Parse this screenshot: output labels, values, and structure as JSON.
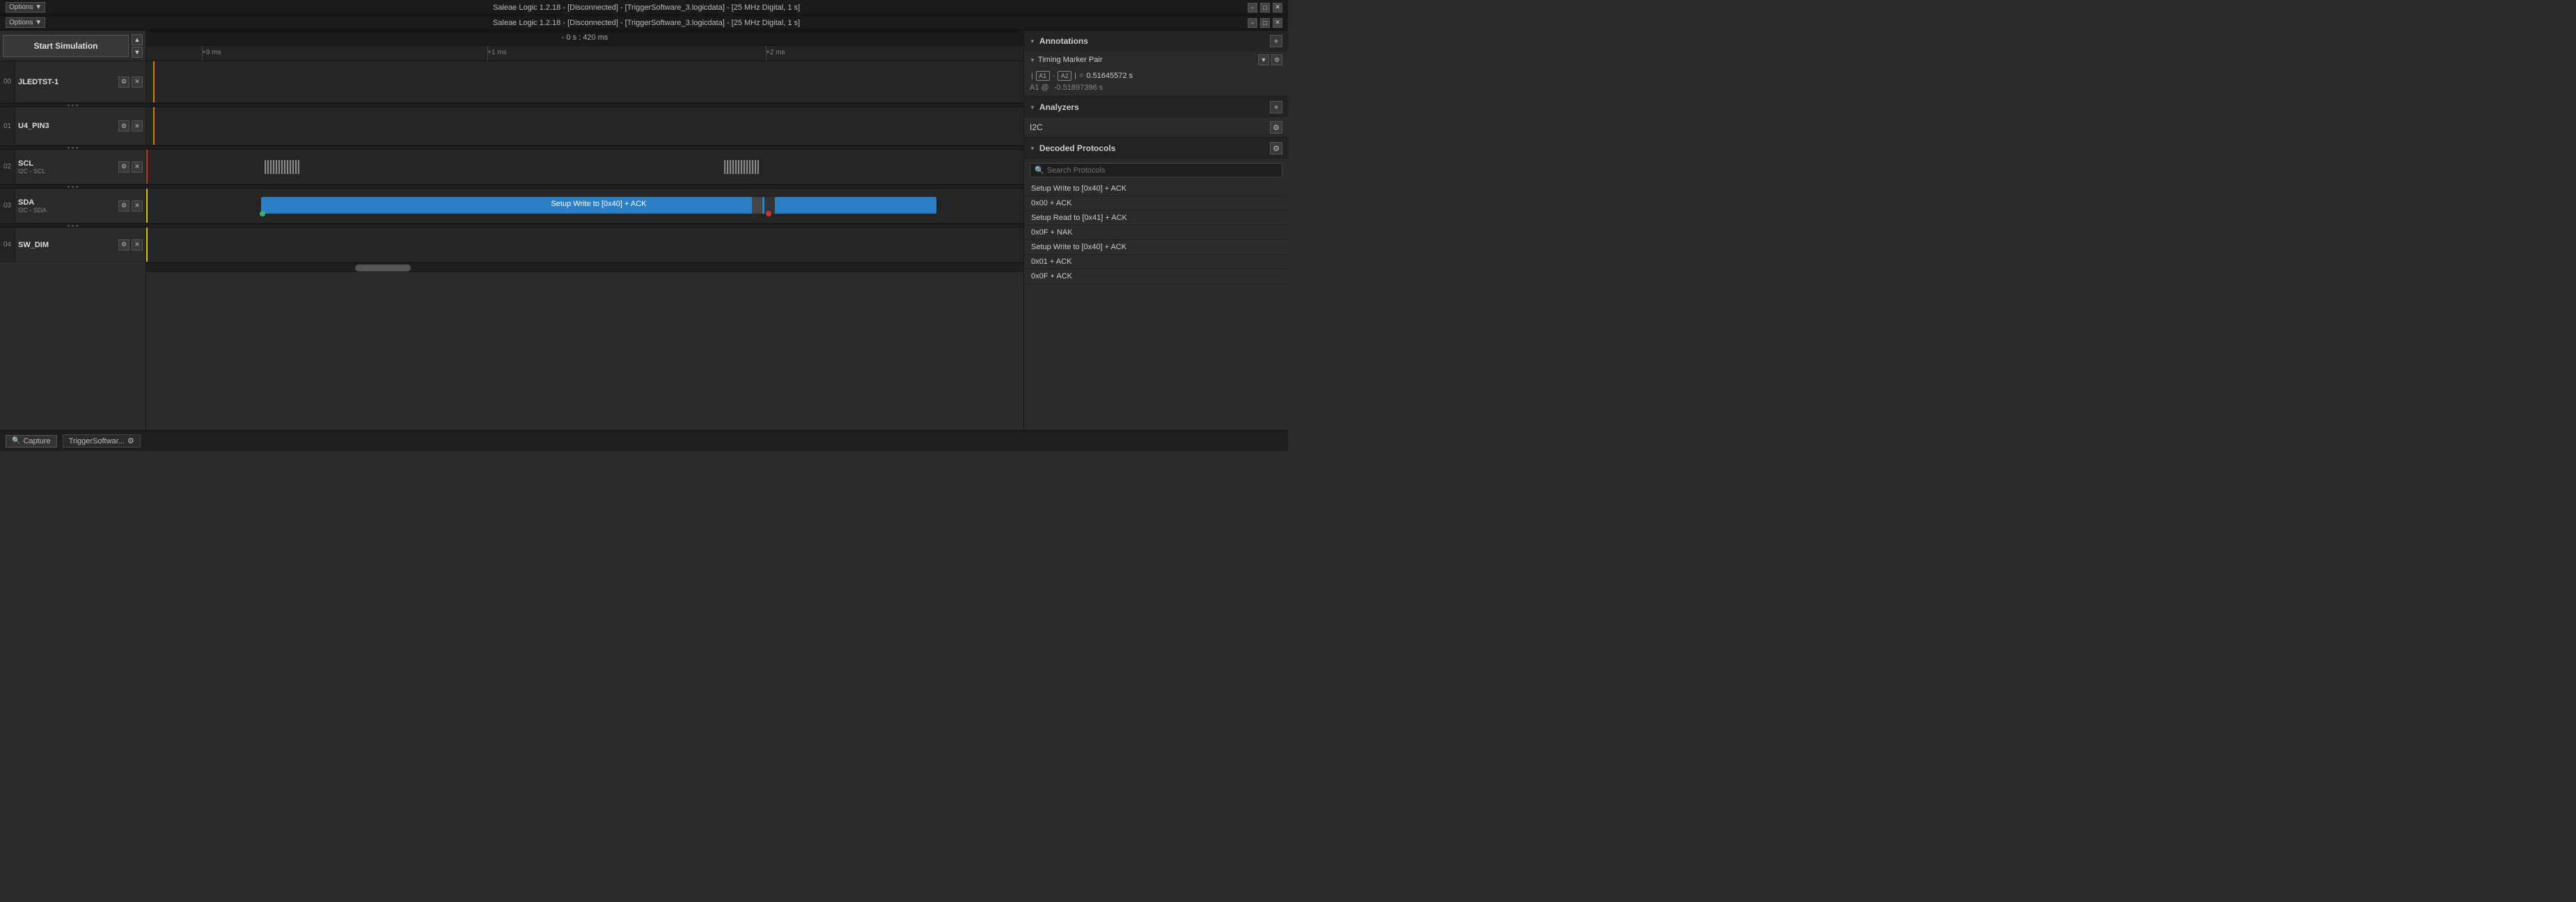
{
  "titlebar1": {
    "text": "Saleae Logic 1.2.18 - [Disconnected] - [TriggerSoftware_3.logicdata] - [25 MHz Digital, 1 s]",
    "options": "Options ▼",
    "minimize": "−",
    "maximize": "□",
    "close": "✕"
  },
  "titlebar2": {
    "text": "Saleae Logic 1.2.18 - [Disconnected] - [TriggerSoftware_3.logicdata] - [25 MHz Digital, 1 s]",
    "options": "Options ▼",
    "minimize": "−",
    "maximize": "□",
    "close": "✕"
  },
  "header": {
    "start_sim": "Start Simulation",
    "time_range": "- 0 s : 420 ms"
  },
  "timeline": {
    "tick1": "+9 ms",
    "tick2": "+1 ms",
    "tick3": "+2 ms"
  },
  "channels": [
    {
      "index": "00",
      "name": "JLEDTST-1",
      "sub": "",
      "height": "tall"
    },
    {
      "index": "01",
      "name": "U4_PIN3",
      "sub": "",
      "height": "medium"
    },
    {
      "index": "02",
      "name": "SCL",
      "sub": "I2C - SCL",
      "height": "short"
    },
    {
      "index": "03",
      "name": "SDA",
      "sub": "I2C - SDA",
      "height": "short"
    },
    {
      "index": "04",
      "name": "SW_DIM",
      "sub": "",
      "height": "short"
    }
  ],
  "waveform": {
    "cursor_label": "Setup Write to [0x40] + ACK"
  },
  "right_panel": {
    "annotations": {
      "title": "Annotations",
      "timing_marker": "Timing Marker Pair",
      "a1_label": "A1",
      "a2_label": "A2",
      "equals": "=",
      "value": "0.51645572 s",
      "a1_at": "A1 @",
      "a1_offset": "-0.51897396 s"
    },
    "analyzers": {
      "title": "Analyzers",
      "i2c_name": "I2C"
    },
    "decoded": {
      "title": "Decoded Protocols",
      "search_placeholder": "Search Protocols",
      "protocols": [
        "Setup Write to [0x40] + ACK",
        "0x00 + ACK",
        "Setup Read to [0x41] + ACK",
        "0x0F + NAK",
        "Setup Write to [0x40] + ACK",
        "0x01 + ACK",
        "0x0F + ACK"
      ]
    }
  },
  "bottom": {
    "capture_label": "Capture",
    "file_label": "TriggerSoftwar...",
    "gear_icon": "⚙"
  },
  "icons": {
    "search": "🔍",
    "gear": "⚙",
    "plus": "+",
    "triangle_down": "▼",
    "triangle_right": "▶",
    "close": "✕",
    "filter": "▼",
    "up_arrow": "▲",
    "down_arrow": "▼"
  }
}
